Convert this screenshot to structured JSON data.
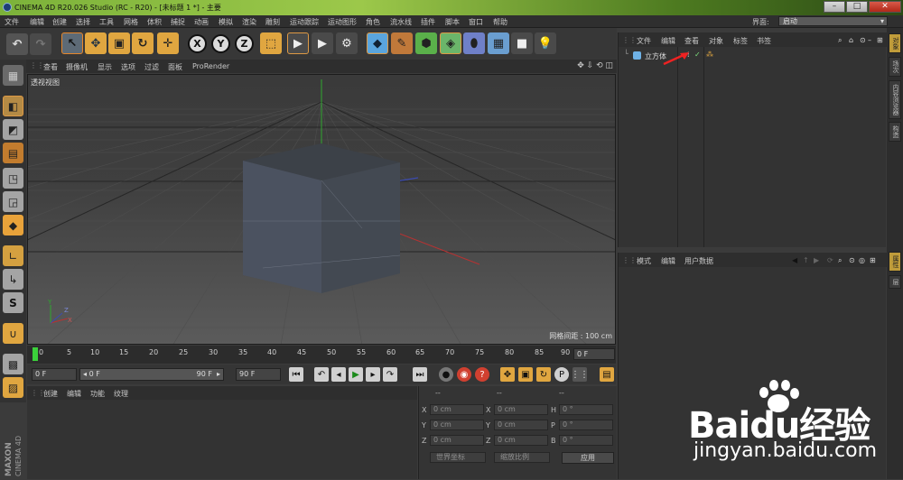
{
  "window": {
    "title": "CINEMA 4D R20.026 Studio (RC - R20) - [未标题 1 *] - 主要",
    "controls": [
      "–",
      "□",
      "✕"
    ]
  },
  "menu": [
    "文件",
    "编辑",
    "创建",
    "选择",
    "工具",
    "网格",
    "体积",
    "捕捉",
    "动画",
    "模拟",
    "渲染",
    "雕刻",
    "运动跟踪",
    "运动图形",
    "角色",
    "流水线",
    "插件",
    "脚本",
    "窗口",
    "帮助"
  ],
  "layout": {
    "label": "界面:",
    "value": "启动"
  },
  "viewport_menu": [
    "查看",
    "摄像机",
    "显示",
    "选项",
    "过滤",
    "面板",
    "ProRender"
  ],
  "viewport": {
    "label": "透视视图",
    "grid_info": "网格间距 : 100 cm"
  },
  "timeline": {
    "ticks": [
      "0",
      "5",
      "10",
      "15",
      "20",
      "25",
      "30",
      "35",
      "40",
      "45",
      "50",
      "55",
      "60",
      "65",
      "70",
      "75",
      "80",
      "85",
      "90"
    ],
    "end_frame": "0 F"
  },
  "transport": {
    "current_frame": "0 F",
    "range_start": "0 F",
    "range_end": "90 F",
    "max_frame": "90 F"
  },
  "material_menu": [
    "创建",
    "编辑",
    "功能",
    "纹理"
  ],
  "coords": {
    "headers": [
      "--",
      "--",
      "--"
    ],
    "rows": [
      {
        "a": "X",
        "av": "0 cm",
        "b": "X",
        "bv": "0 cm",
        "c": "H",
        "cv": "0 °"
      },
      {
        "a": "Y",
        "av": "0 cm",
        "b": "Y",
        "bv": "0 cm",
        "c": "P",
        "cv": "0 °"
      },
      {
        "a": "Z",
        "av": "0 cm",
        "b": "Z",
        "bv": "0 cm",
        "c": "B",
        "cv": "0 °"
      }
    ],
    "world": "世界坐标",
    "scale": "缩放比例",
    "apply": "应用"
  },
  "object_menu": [
    "文件",
    "编辑",
    "查看",
    "对象",
    "标签",
    "书签"
  ],
  "objects": [
    {
      "name": "立方体"
    }
  ],
  "attr_menu": [
    "模式",
    "编辑",
    "用户数据"
  ],
  "right_tabs": [
    "对象",
    "场次",
    "内容浏览器",
    "构造",
    "属性",
    "层"
  ],
  "branding": {
    "maxon": "MAXON",
    "product": "CINEMA 4D"
  },
  "watermark": {
    "brand": "Baidu经验",
    "url": "jingyan.baidu.com"
  }
}
